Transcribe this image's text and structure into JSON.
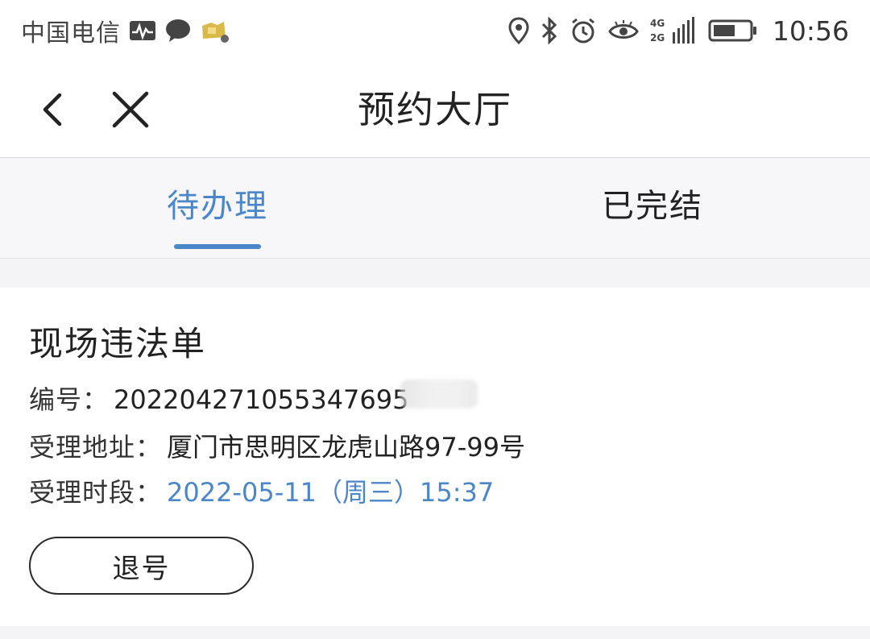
{
  "status_bar": {
    "carrier": "中国电信",
    "network_label_top": "4G",
    "network_label_bottom": "2G",
    "time": "10:56",
    "icons": [
      "activity-icon",
      "chat-icon",
      "app-notification-icon",
      "location-icon",
      "bluetooth-icon",
      "alarm-icon",
      "eye-comfort-icon",
      "signal-icon",
      "battery-icon"
    ]
  },
  "nav": {
    "title": "预约大厅",
    "back_icon": "chevron-left-icon",
    "close_icon": "close-icon"
  },
  "tabs": {
    "items": [
      {
        "label": "待办理",
        "active": true
      },
      {
        "label": "已完结",
        "active": false
      }
    ],
    "active_color": "#4a86c8"
  },
  "appointment": {
    "title": "现场违法单",
    "number_label": "编号：",
    "number_value": "202204271055347695",
    "address_label": "受理地址：",
    "address_value": "厦门市思明区龙虎山路97-99号",
    "time_label": "受理时段：",
    "time_value": "2022-05-11（周三）15:37",
    "cancel_button": "退号"
  }
}
